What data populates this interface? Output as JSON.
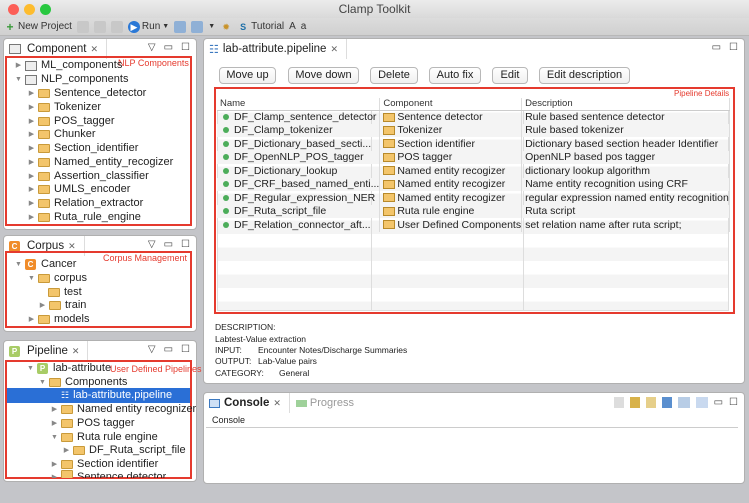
{
  "window": {
    "title": "Clamp Toolkit"
  },
  "toolbar": {
    "new_project": "New Project",
    "run": "Run",
    "tutorial": "Tutorial",
    "font_a_upper": "A",
    "font_a_lower": "a"
  },
  "component_panel": {
    "tab": "Component",
    "annotation": "NLP Components",
    "roots": [
      {
        "label": "ML_components",
        "expanded": false
      },
      {
        "label": "NLP_components",
        "expanded": true
      }
    ],
    "items": [
      "Sentence_detector",
      "Tokenizer",
      "POS_tagger",
      "Chunker",
      "Section_identifier",
      "Named_entity_recogizer",
      "Assertion_classifier",
      "UMLS_encoder",
      "Relation_extractor",
      "Ruta_rule_engine"
    ]
  },
  "corpus_panel": {
    "tab": "Corpus",
    "annotation": "Corpus Management",
    "root": "Cancer",
    "corpus": "corpus",
    "test": "test",
    "train": "train",
    "models": "models"
  },
  "pipeline_panel": {
    "tab": "Pipeline",
    "annotation": "User Defined Pipelines",
    "root": "lab-attribute",
    "components": "Components",
    "selected": "lab-attribute.pipeline",
    "ner": "Named entity recognizer",
    "pos": "POS tagger",
    "ruta": "Ruta rule engine",
    "ruta_file": "DF_Ruta_script_file",
    "section": "Section identifier",
    "partial": "Sentence detector"
  },
  "editor": {
    "tab": "lab-attribute.pipeline",
    "buttons": [
      "Move up",
      "Move down",
      "Delete",
      "Auto fix",
      "Edit",
      "Edit description"
    ],
    "annotation": "Pipeline Details",
    "columns": [
      "Name",
      "Component",
      "Description"
    ],
    "rows": [
      {
        "name": "DF_Clamp_sentence_detector",
        "component": "Sentence detector",
        "description": "Rule based sentence detector"
      },
      {
        "name": "DF_Clamp_tokenizer",
        "component": "Tokenizer",
        "description": "Rule based tokenizer"
      },
      {
        "name": "DF_Dictionary_based_secti...",
        "component": "Section identifier",
        "description": "Dictionary based section header Identifier"
      },
      {
        "name": "DF_OpenNLP_POS_tagger",
        "component": "POS tagger",
        "description": "OpenNLP based pos tagger"
      },
      {
        "name": "DF_Dictionary_lookup",
        "component": "Named entity recogizer",
        "description": "dictionary lookup algorithm"
      },
      {
        "name": "DF_CRF_based_named_enti...",
        "component": "Named entity recogizer",
        "description": "Name entity recognition using CRF"
      },
      {
        "name": "DF_Regular_expression_NER",
        "component": "Named entity recogizer",
        "description": "regular expression named entity recognition"
      },
      {
        "name": "DF_Ruta_script_file",
        "component": "Ruta rule engine",
        "description": "Ruta script"
      },
      {
        "name": "DF_Relation_connector_aft...",
        "component": "User Defined Components",
        "description": "set relation name after ruta script;"
      }
    ],
    "meta": {
      "description_label": "DESCRIPTION:",
      "description": "Labtest-Value extraction",
      "input_label": "INPUT:",
      "input": "Encounter Notes/Discharge Summaries",
      "output_label": "OUTPUT:",
      "output": "Lab-Value pairs",
      "category_label": "CATEGORY:",
      "category": "General"
    }
  },
  "console": {
    "tab": "Console",
    "progress_tab": "Progress",
    "header": "Console"
  },
  "colors": {
    "annotation": "#e53a2e",
    "selection": "#2a6fd6"
  }
}
